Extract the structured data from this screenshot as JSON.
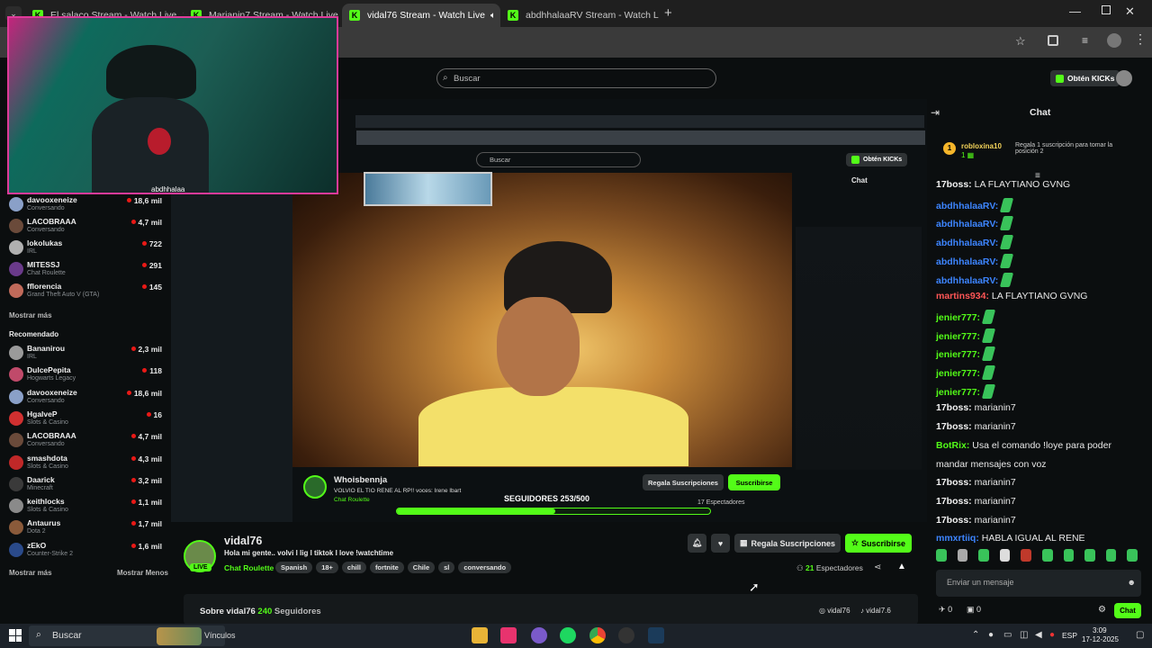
{
  "tabs": [
    {
      "label": "El salaco Stream - Watch Live",
      "active": false
    },
    {
      "label": "Marianin7 Stream - Watch Live",
      "active": false
    },
    {
      "label": "vidal76 Stream - Watch Live",
      "active": true
    },
    {
      "label": "abdhhalaaRV Stream - Watch Live",
      "active": false
    }
  ],
  "header": {
    "search_placeholder": "Buscar",
    "kick_button": "Obtén KICKs"
  },
  "sidebar": {
    "following": [
      {
        "name": "davooxeneize",
        "category": "Conversando",
        "viewers": "18,6 mil",
        "color": "#8aa0c8"
      },
      {
        "name": "LACOBRAAA",
        "category": "Conversando",
        "viewers": "4,7 mil",
        "color": "#6a4a3a"
      },
      {
        "name": "lokolukas",
        "category": "IRL",
        "viewers": "722",
        "color": "#b0b0b0"
      },
      {
        "name": "MITESSJ",
        "category": "Chat Roulette",
        "viewers": "291",
        "color": "#6a3a8a"
      },
      {
        "name": "fflorencia",
        "category": "Grand Theft Auto V (GTA)",
        "viewers": "145",
        "color": "#c06a5a"
      }
    ],
    "show_more": "Mostrar más",
    "recommended_label": "Recomendado",
    "recommended": [
      {
        "name": "Bananirou",
        "category": "IRL",
        "viewers": "2,3 mil",
        "color": "#9a9a9a"
      },
      {
        "name": "DulcePepita",
        "category": "Hogwarts Legacy",
        "viewers": "118",
        "color": "#c04a6a"
      },
      {
        "name": "davooxeneize",
        "category": "Conversando",
        "viewers": "18,6 mil",
        "color": "#8aa0c8"
      },
      {
        "name": "HgalveP",
        "category": "Slots & Casino",
        "viewers": "16",
        "color": "#d03030"
      },
      {
        "name": "LACOBRAAA",
        "category": "Conversando",
        "viewers": "4,7 mil",
        "color": "#6a4a3a"
      },
      {
        "name": "smashdota",
        "category": "Slots & Casino",
        "viewers": "4,3 mil",
        "color": "#c02828"
      },
      {
        "name": "Daarick",
        "category": "Minecraft",
        "viewers": "3,2 mil",
        "color": "#3a3a3a"
      },
      {
        "name": "keithlocks",
        "category": "Slots & Casino",
        "viewers": "1,1 mil",
        "color": "#8a8a8a"
      },
      {
        "name": "Antaurus",
        "category": "Dota 2",
        "viewers": "1,7 mil",
        "color": "#8a5a3a"
      },
      {
        "name": "zEkO",
        "category": "Counter-Strike 2",
        "viewers": "1,6 mil",
        "color": "#2a4a8a"
      }
    ],
    "show_more2": "Mostrar más",
    "show_less": "Mostrar Menos"
  },
  "capture": {
    "nested_search": "Buscar",
    "nested_kick": "Obtén KICKs",
    "nested_chat": "Chat",
    "nested_streamer": "Whoisbennja",
    "nested_title": "VOLVIO EL TIO RENE AL RP!! voces: Irene Ibart",
    "nested_category": "Chat Roulette",
    "nested_followers_overlay": "SEGUIDORES 253/500",
    "nested_sub_btn": "Regala Suscripciones",
    "nested_follow_btn": "Suscribirse",
    "nested_viewers": "17 Espectadores",
    "webcam_caption": "abdhhalaa"
  },
  "stream": {
    "channel": "vidal76",
    "live_badge": "LIVE",
    "title": "Hola mi gente.. volvi l lig l tiktok l love !watchtime",
    "category": "Chat Roulette",
    "tags": [
      "Spanish",
      "18+",
      "chill",
      "fortnite",
      "Chile",
      "sl",
      "conversando"
    ],
    "gift_btn": "Regala Suscripciones",
    "subscribe_btn": "Suscribirse",
    "viewers": "21",
    "viewers_label": "Espectadores",
    "about": "Sobre vidal76",
    "followers_count": "240",
    "followers_label": "Seguidores",
    "social_ig": "vidal76",
    "social_tiktok": "vidal7.6"
  },
  "chat": {
    "title": "Chat",
    "pinned_user": "robloxina10",
    "pinned_count": "1",
    "pinned_text": "Regala 1 suscripción para tomar la posición 2",
    "messages": [
      {
        "user": "17boss:",
        "text": "LA FLAYTIANO GVNG",
        "color": "white",
        "emote": false
      },
      {
        "user": "abdhhalaaRV:",
        "text": "",
        "color": "blue",
        "emote": true
      },
      {
        "user": "abdhhalaaRV:",
        "text": "",
        "color": "blue",
        "emote": true
      },
      {
        "user": "abdhhalaaRV:",
        "text": "",
        "color": "blue",
        "emote": true
      },
      {
        "user": "abdhhalaaRV:",
        "text": "",
        "color": "blue",
        "emote": true
      },
      {
        "user": "abdhhalaaRV:",
        "text": "",
        "color": "blue",
        "emote": true
      },
      {
        "user": "martins934:",
        "text": "LA FLAYTIANO GVNG",
        "color": "red",
        "emote": false
      },
      {
        "user": "jenier777:",
        "text": "",
        "color": "green",
        "emote": true
      },
      {
        "user": "jenier777:",
        "text": "",
        "color": "green",
        "emote": true
      },
      {
        "user": "jenier777:",
        "text": "",
        "color": "green",
        "emote": true
      },
      {
        "user": "jenier777:",
        "text": "",
        "color": "green",
        "emote": true
      },
      {
        "user": "jenier777:",
        "text": "",
        "color": "green",
        "emote": true
      },
      {
        "user": "17boss:",
        "text": "marianin7",
        "color": "white",
        "emote": false
      },
      {
        "user": "17boss:",
        "text": "marianin7",
        "color": "white",
        "emote": false
      },
      {
        "user": "BotRix:",
        "text": "Usa el comando !loye para poder",
        "color": "green",
        "emote": false
      },
      {
        "user": "",
        "text": "mandar mensajes con voz",
        "color": "white",
        "emote": false
      },
      {
        "user": "17boss:",
        "text": "marianin7",
        "color": "white",
        "emote": false
      },
      {
        "user": "17boss:",
        "text": "marianin7",
        "color": "white",
        "emote": false
      },
      {
        "user": "17boss:",
        "text": "marianin7",
        "color": "white",
        "emote": false
      },
      {
        "user": "mmxrtiiq:",
        "text": "HABLA IGUAL AL RENE",
        "color": "blue",
        "emote": false
      }
    ],
    "input_placeholder": "Enviar un mensaje",
    "kicks_count": "0",
    "gifts_count": "0",
    "send_btn": "Chat"
  },
  "taskbar": {
    "search": "Buscar",
    "widget": "Vínculos",
    "lang": "ESP",
    "time": "3:09",
    "date": "17-12-2025"
  }
}
